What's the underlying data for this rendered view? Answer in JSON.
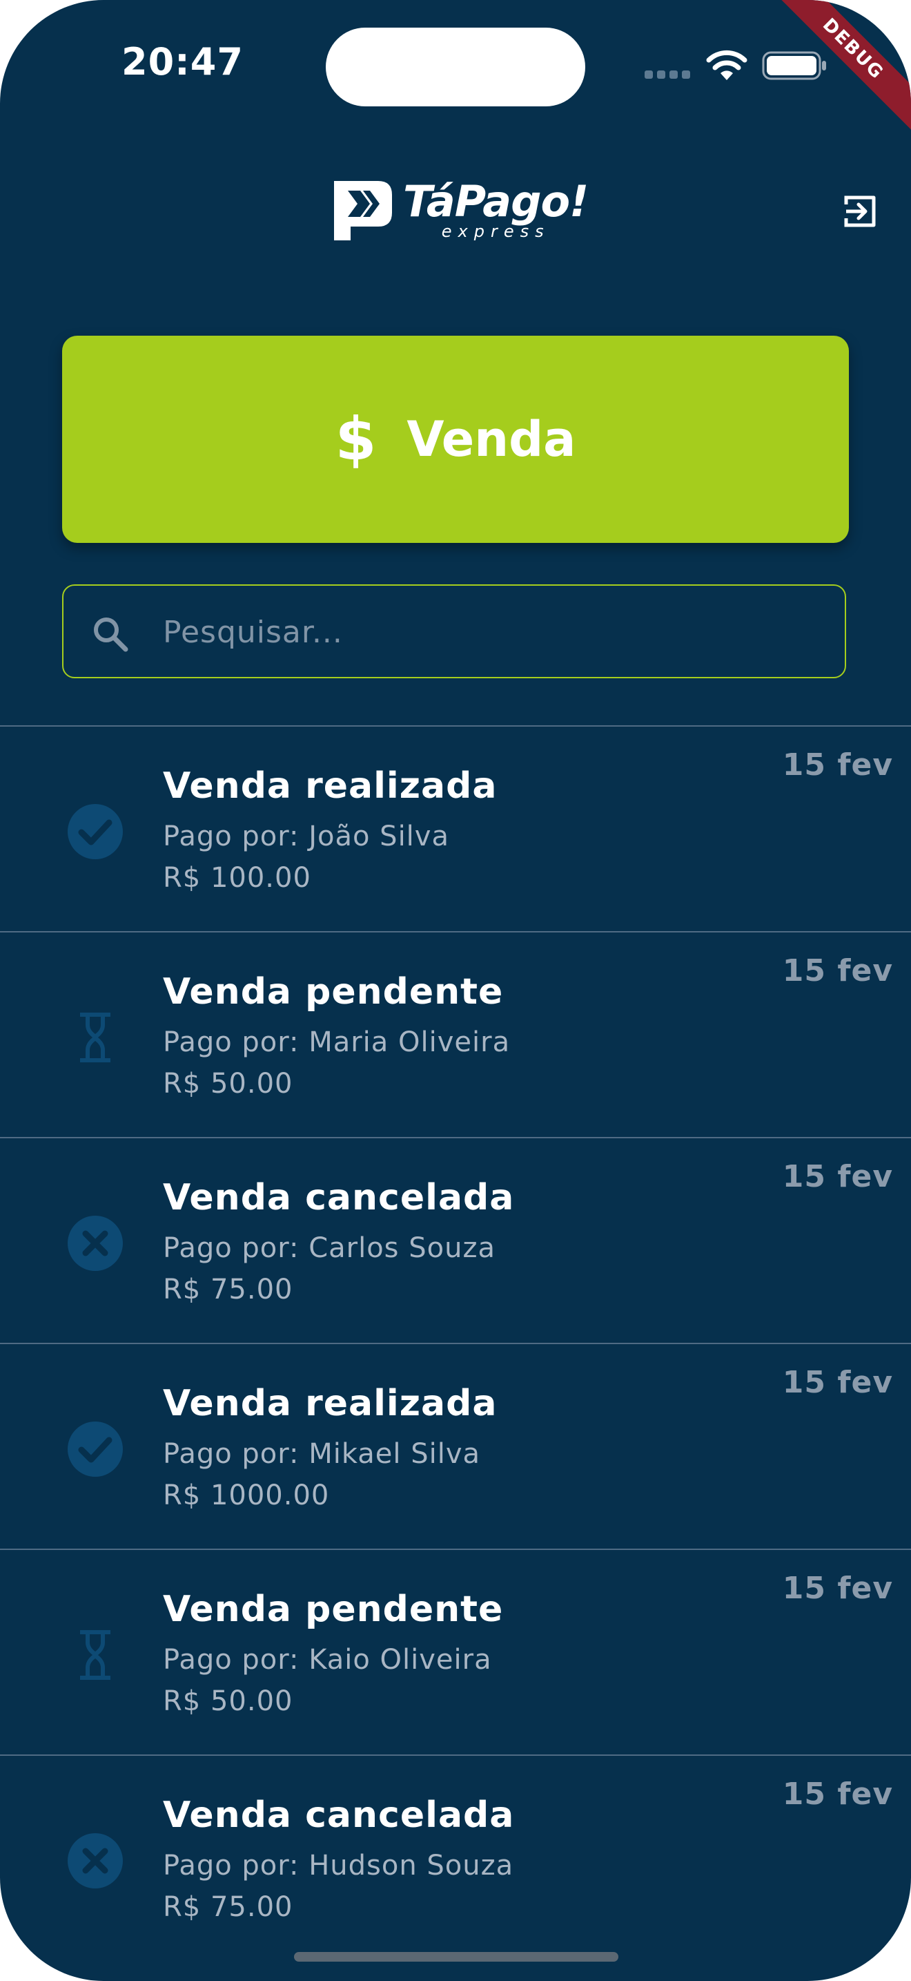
{
  "status_bar": {
    "time": "20:47",
    "debug_label": "DEBUG"
  },
  "header": {
    "logo_name": "TáPago!",
    "logo_sub": "express",
    "logout_icon": "logout-icon"
  },
  "actions": {
    "venda_icon": "$",
    "venda_label": "Venda"
  },
  "search": {
    "placeholder": "Pesquisar...",
    "value": ""
  },
  "colors": {
    "background": "#06304d",
    "accent": "#a5cd1d",
    "status_icon": "#0d4a74"
  },
  "transactions": [
    {
      "title": "Venda realizada",
      "payer": "Pago por: João Silva",
      "amount": "R$ 100.00",
      "date": "15 fev",
      "status": "check-circle-icon"
    },
    {
      "title": "Venda pendente",
      "payer": "Pago por: Maria Oliveira",
      "amount": "R$ 50.00",
      "date": "15 fev",
      "status": "hourglass-icon"
    },
    {
      "title": "Venda cancelada",
      "payer": "Pago por: Carlos Souza",
      "amount": "R$ 75.00",
      "date": "15 fev",
      "status": "cancel-circle-icon"
    },
    {
      "title": "Venda realizada",
      "payer": "Pago por: Mikael Silva",
      "amount": "R$ 1000.00",
      "date": "15 fev",
      "status": "check-circle-icon"
    },
    {
      "title": "Venda pendente",
      "payer": "Pago por: Kaio Oliveira",
      "amount": "R$ 50.00",
      "date": "15 fev",
      "status": "hourglass-icon"
    },
    {
      "title": "Venda cancelada",
      "payer": "Pago por: Hudson Souza",
      "amount": "R$ 75.00",
      "date": "15 fev",
      "status": "cancel-circle-icon"
    }
  ]
}
